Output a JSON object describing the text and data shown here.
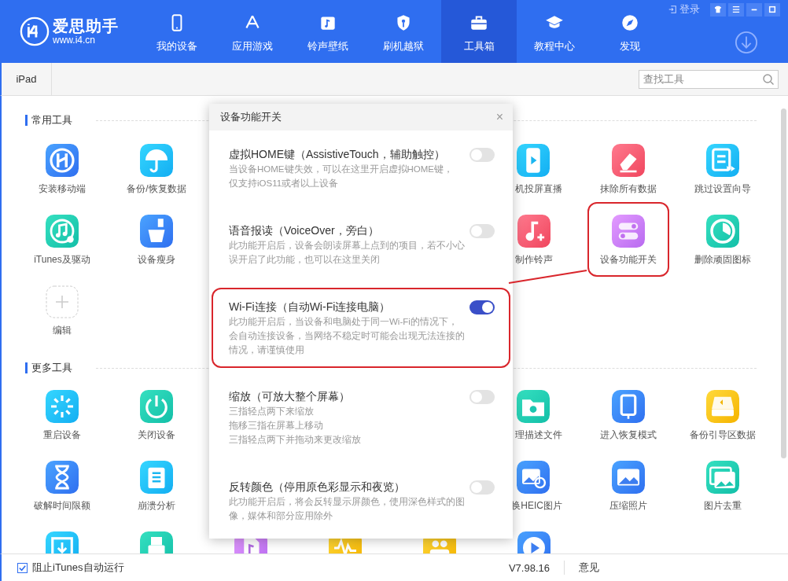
{
  "app": {
    "logo_text": "爱思助手",
    "logo_url": "www.i4.cn",
    "login": "登录"
  },
  "nav": [
    {
      "label": "我的设备",
      "selected": false
    },
    {
      "label": "应用游戏",
      "selected": false
    },
    {
      "label": "铃声壁纸",
      "selected": false
    },
    {
      "label": "刷机越狱",
      "selected": false
    },
    {
      "label": "工具箱",
      "selected": true
    },
    {
      "label": "教程中心",
      "selected": false
    },
    {
      "label": "发现",
      "selected": false
    }
  ],
  "device_tabs": [
    {
      "label": "iPad"
    }
  ],
  "search": {
    "placeholder": "查找工具"
  },
  "sections": [
    {
      "title": "常用工具",
      "rows": [
        [
          {
            "kind": "tool",
            "label": "安装移动端"
          },
          {
            "kind": "tool",
            "label": "备份/恢复数据"
          },
          {
            "kind": "covered"
          },
          {
            "kind": "covered"
          },
          {
            "kind": "covered"
          },
          {
            "kind": "tool",
            "label": "机投屏直播",
            "cut": true
          },
          {
            "kind": "tool",
            "label": "抹除所有数据"
          },
          {
            "kind": "tool",
            "label": "跳过设置向导"
          }
        ],
        [
          {
            "kind": "tool",
            "label": "iTunes及驱动"
          },
          {
            "kind": "tool",
            "label": "设备瘦身"
          },
          {
            "kind": "covered"
          },
          {
            "kind": "covered"
          },
          {
            "kind": "covered"
          },
          {
            "kind": "tool",
            "label": "制作铃声"
          },
          {
            "kind": "tool",
            "label": "设备功能开关",
            "callout": true
          },
          {
            "kind": "tool",
            "label": "删除顽固图标"
          }
        ],
        [
          {
            "kind": "add",
            "label": "编辑"
          }
        ]
      ]
    },
    {
      "title": "更多工具",
      "rows": [
        [
          {
            "kind": "tool",
            "label": "重启设备"
          },
          {
            "kind": "tool",
            "label": "关闭设备"
          },
          {
            "kind": "covered"
          },
          {
            "kind": "covered"
          },
          {
            "kind": "covered"
          },
          {
            "kind": "tool",
            "label": "理描述文件",
            "cut": true
          },
          {
            "kind": "tool",
            "label": "进入恢复模式"
          },
          {
            "kind": "tool",
            "label": "备份引导区数据"
          }
        ],
        [
          {
            "kind": "tool",
            "label": "破解时间限额"
          },
          {
            "kind": "tool",
            "label": "崩溃分析"
          },
          {
            "kind": "covered"
          },
          {
            "kind": "covered"
          },
          {
            "kind": "covered"
          },
          {
            "kind": "tool",
            "label": "换HEIC图片",
            "cut": true
          },
          {
            "kind": "tool",
            "label": "压缩照片"
          },
          {
            "kind": "tool",
            "label": "图片去重"
          }
        ],
        [
          {
            "kind": "tool"
          },
          {
            "kind": "tool"
          },
          {
            "kind": "tool"
          },
          {
            "kind": "tool"
          },
          {
            "kind": "tool"
          },
          {
            "kind": "tool"
          }
        ]
      ]
    }
  ],
  "dialog": {
    "title": "设备功能开关",
    "close": "×",
    "items": [
      {
        "title": "虚拟HOME键（AssistiveTouch，辅助触控）",
        "description": [
          "当设备HOME键失效，可以在这里开启虚拟HOME键，",
          "仅支持iOS11或者以上设备"
        ],
        "on": false,
        "callout": false
      },
      {
        "title": "语音报读（VoiceOver，旁白）",
        "description": [
          "此功能开启后，设备会朗读屏幕上点到的项目，若不小心",
          "误开启了此功能，也可以在这里关闭"
        ],
        "on": false,
        "callout": false
      },
      {
        "title": "Wi-Fi连接（自动Wi-Fi连接电脑）",
        "description": [
          "此功能开启后，当设备和电脑处于同一Wi-Fi的情况下，",
          "会自动连接设备，当网络不稳定时可能会出现无法连接的",
          "情况，请谨慎使用"
        ],
        "on": true,
        "callout": true
      },
      {
        "title": "缩放（可放大整个屏幕）",
        "description": [
          "三指轻点两下来缩放",
          "拖移三指在屏幕上移动",
          "三指轻点两下并拖动来更改缩放"
        ],
        "on": false,
        "callout": false
      },
      {
        "title": "反转颜色（停用原色彩显示和夜览）",
        "description": [
          "此功能开启后，将会反转显示屏颜色，使用深色样式的图",
          "像，媒体和部分应用除外"
        ],
        "on": false,
        "callout": false
      }
    ]
  },
  "footer": {
    "checkbox": {
      "label": "阻止iTunes自动运行",
      "checked": true
    },
    "version": "V7.98.16",
    "feedback": "意见"
  }
}
